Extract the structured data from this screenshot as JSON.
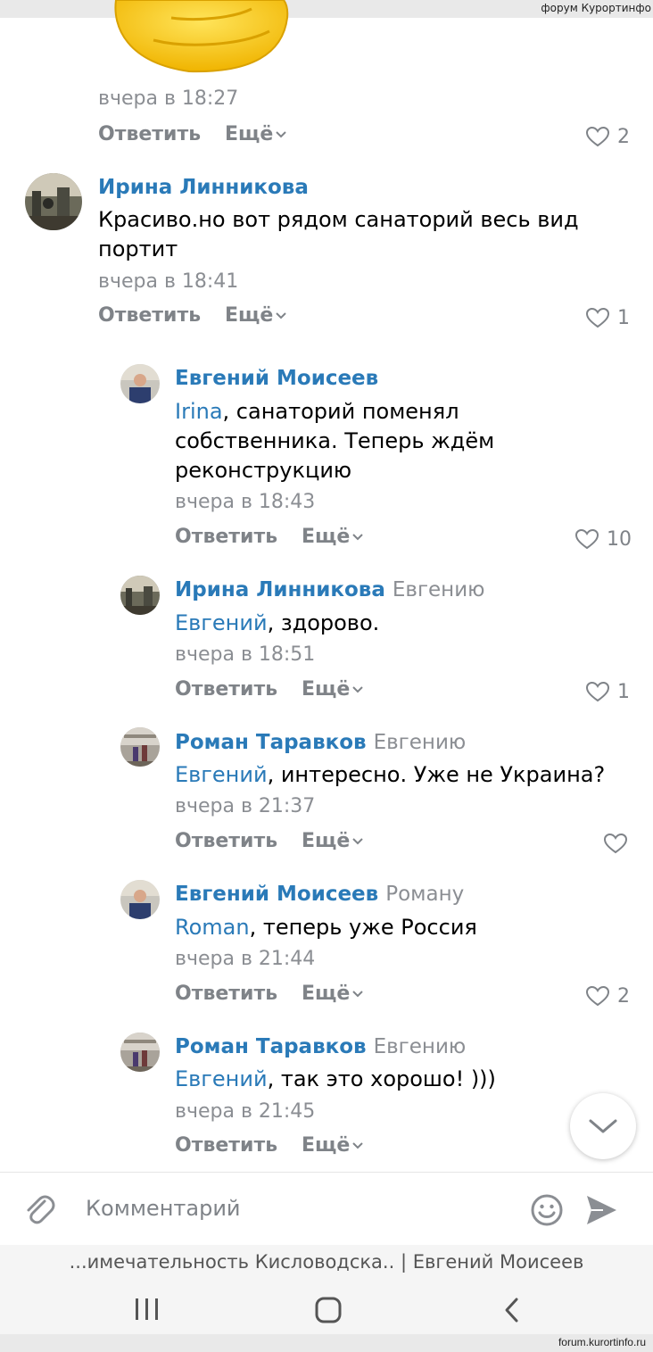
{
  "watermark_top": "форум Курортинфо",
  "watermark_bottom": "forum.kurortinfo.ru",
  "actions": {
    "reply": "Ответить",
    "more": "Ещё"
  },
  "comments": [
    {
      "time": "вчера в 18:27",
      "likes": "2"
    },
    {
      "author": "Ирина Линникова",
      "text": "Красиво.но вот рядом санаторий весь вид портит",
      "time": "вчера в 18:41",
      "likes": "1"
    },
    {
      "author": "Евгений Моисеев",
      "mention": "Irina",
      "text": ", санаторий поменял собственника. Теперь ждём реконструкцию",
      "time": "вчера в 18:43",
      "likes": "10"
    },
    {
      "author": "Ирина Линникова",
      "reply_to": "Евгению",
      "mention": "Евгений",
      "text": ", здорово.",
      "time": "вчера в 18:51",
      "likes": "1"
    },
    {
      "author": "Роман Таравков",
      "reply_to": "Евгению",
      "mention": "Евгений",
      "text": ", интересно. Уже не Украина?",
      "time": "вчера в 21:37",
      "likes": ""
    },
    {
      "author": "Евгений Моисеев",
      "reply_to": "Роману",
      "mention": "Roman",
      "text": ", теперь уже Россия",
      "time": "вчера в 21:44",
      "likes": "2"
    },
    {
      "author": "Роман Таравков",
      "reply_to": "Евгению",
      "mention": "Евгений",
      "text": ", так это хорошо! )))",
      "time": "вчера в 21:45",
      "likes": ""
    }
  ],
  "composer": {
    "placeholder": "Комментарий"
  },
  "page_title": "...имечательность Кисловодска.. | Евгений Моисеев",
  "colors": {
    "link": "#2a7ab8",
    "muted": "#8b8e93",
    "background": "#ffffff"
  },
  "icons": [
    "paperclip-icon",
    "emoji-icon",
    "send-icon",
    "heart-icon",
    "chevron-down-icon",
    "recent-apps-icon",
    "home-icon",
    "back-icon"
  ]
}
